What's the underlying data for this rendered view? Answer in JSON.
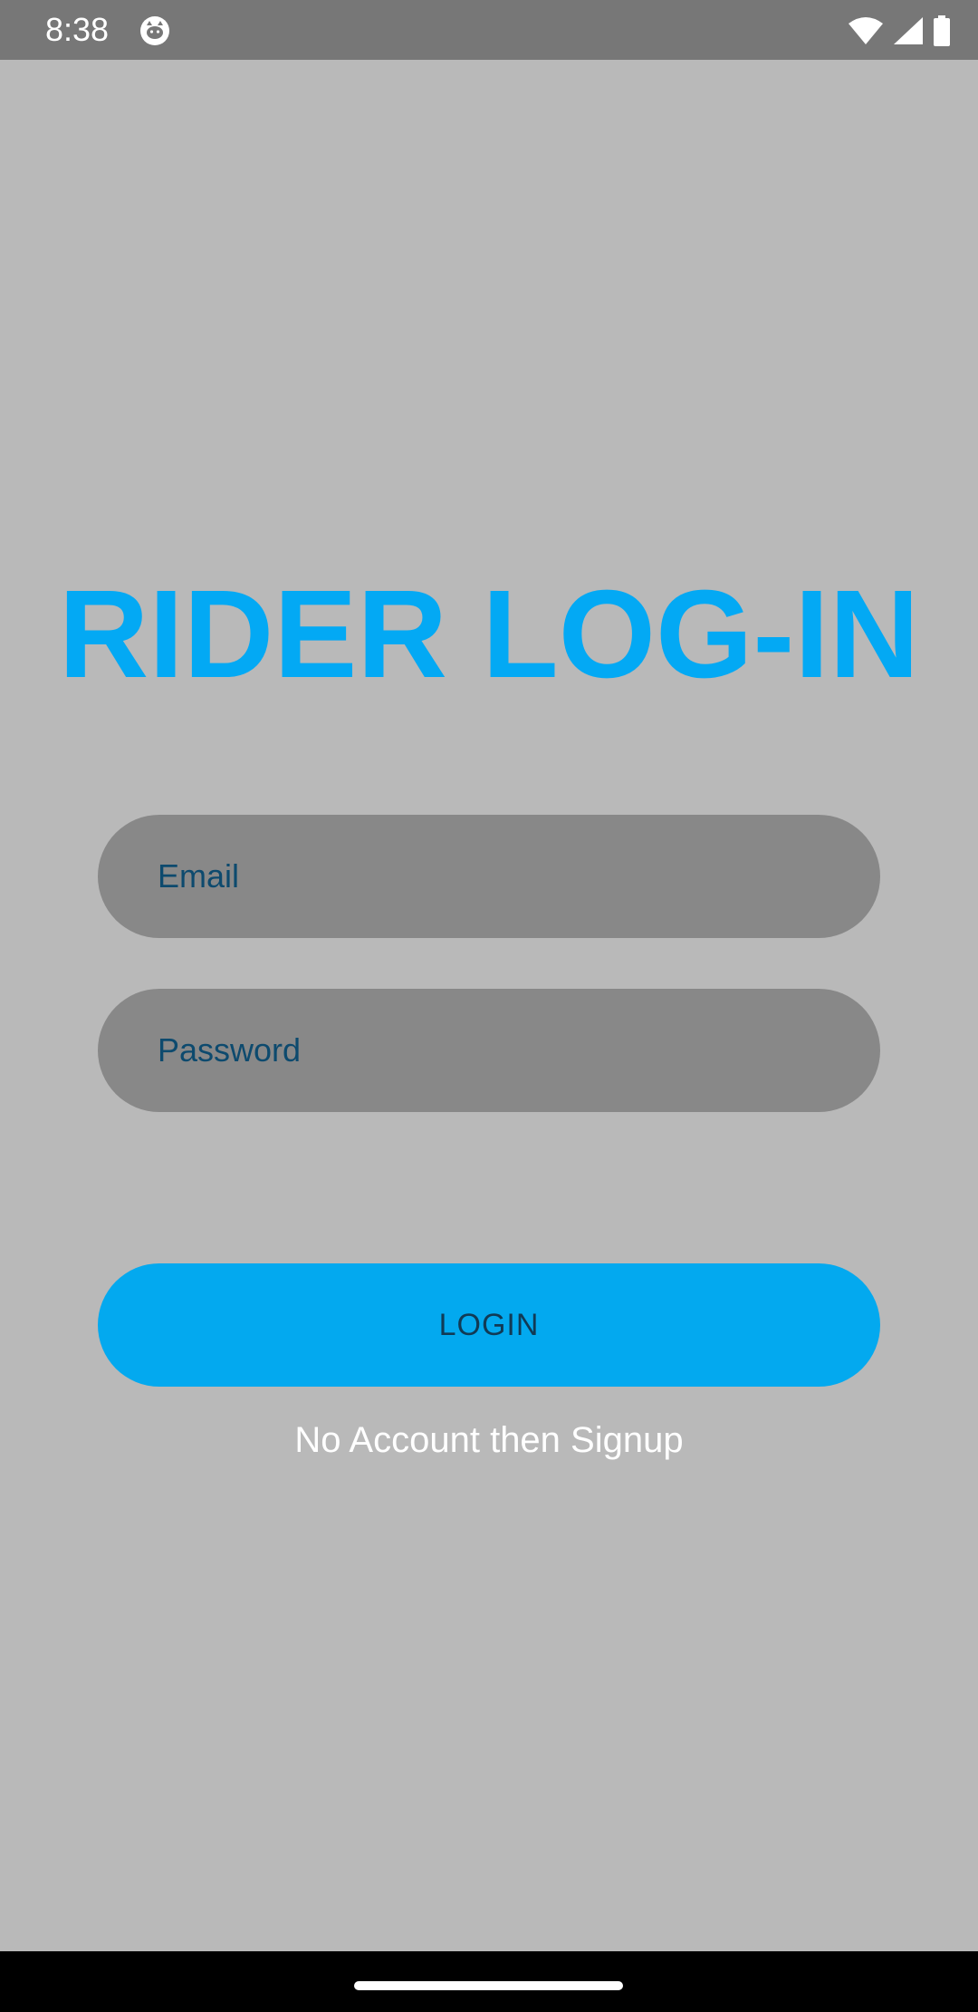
{
  "status_bar": {
    "time": "8:38",
    "icons": [
      "cat-notification-icon",
      "wifi-icon",
      "cell-signal-icon",
      "battery-icon"
    ]
  },
  "title": "RIDER LOG-IN",
  "form": {
    "email_placeholder": "Email",
    "password_placeholder": "Password",
    "login_label": "LOGIN",
    "signup_text": "No Account then Signup"
  },
  "colors": {
    "background": "#b9b9b9",
    "accent": "#03a9f4",
    "input_fill": "#888888",
    "placeholder_text": "#0d4a6e",
    "status_bar": "#777777"
  }
}
